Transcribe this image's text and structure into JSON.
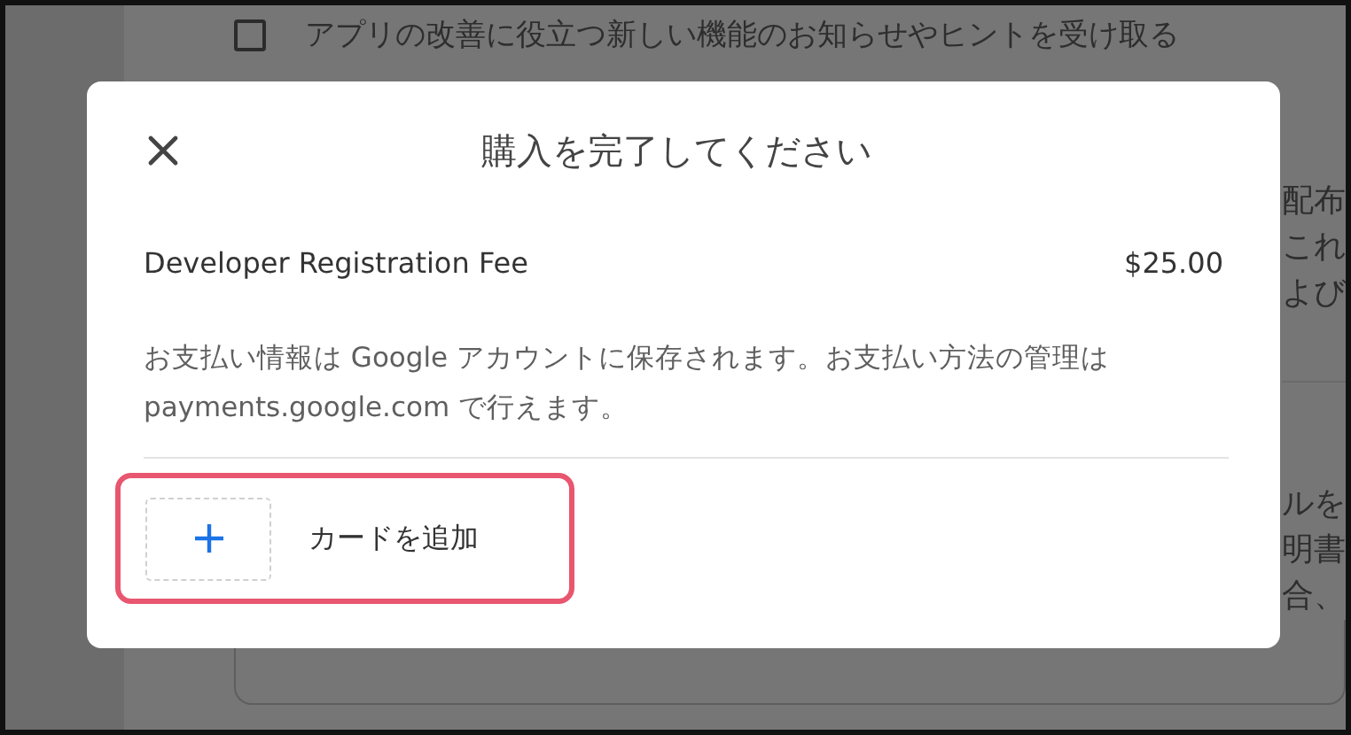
{
  "background": {
    "checkbox": {
      "label": "アプリの改善に役立つ新しい機能のお知らせやヒントを受け取る",
      "checked": false
    },
    "fragment_groups": [
      [
        "配布",
        "これ",
        "よび"
      ],
      [
        "ルを",
        "明書",
        "合、"
      ]
    ]
  },
  "dialog": {
    "title": "購入を完了してください",
    "item": {
      "name": "Developer Registration Fee",
      "price": "$25.00"
    },
    "note": "お支払い情報は Google アカウントに保存されます。お支払い方法の管理は payments.google.com で行えます。",
    "add_card": {
      "label": "カードを追加",
      "highlighted": true
    }
  }
}
